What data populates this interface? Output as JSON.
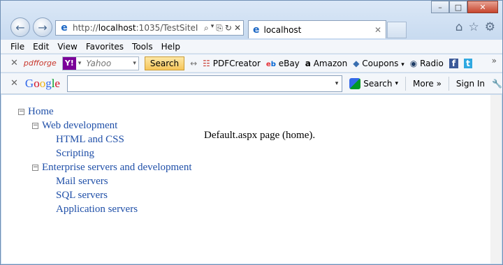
{
  "window": {
    "minimize": "–",
    "maximize": "□",
    "close": "✕"
  },
  "address_bar": {
    "url_prefix": "http://",
    "url_host": "localhost",
    "url_rest": ":1035/TestSiteI"
  },
  "tab": {
    "label": "localhost",
    "close": "✕"
  },
  "menu": [
    "File",
    "Edit",
    "View",
    "Favorites",
    "Tools",
    "Help"
  ],
  "toolbar1": {
    "close": "✕",
    "pdfforge": "pdfforge",
    "yahoo_placeholder": "Yahoo",
    "search_button": "Search",
    "items": {
      "pdfcreator": "PDFCreator",
      "ebay": "eBay",
      "amazon": "Amazon",
      "coupons": "Coupons",
      "radio": "Radio"
    }
  },
  "toolbar2": {
    "close": "✕",
    "google": [
      "G",
      "o",
      "o",
      "g",
      "l",
      "e"
    ],
    "search": "Search",
    "more": "More »",
    "signin": "Sign In"
  },
  "tree": {
    "root": "Home",
    "groups": [
      {
        "label": "Web development",
        "children": [
          "HTML and CSS",
          "Scripting"
        ]
      },
      {
        "label": "Enterprise servers and development",
        "children": [
          "Mail servers",
          "SQL servers",
          "Application servers"
        ]
      }
    ]
  },
  "page_text": "Default.aspx page (home).",
  "colors": {
    "link": "#1f4fa8",
    "frame": "#cfe0f3"
  }
}
